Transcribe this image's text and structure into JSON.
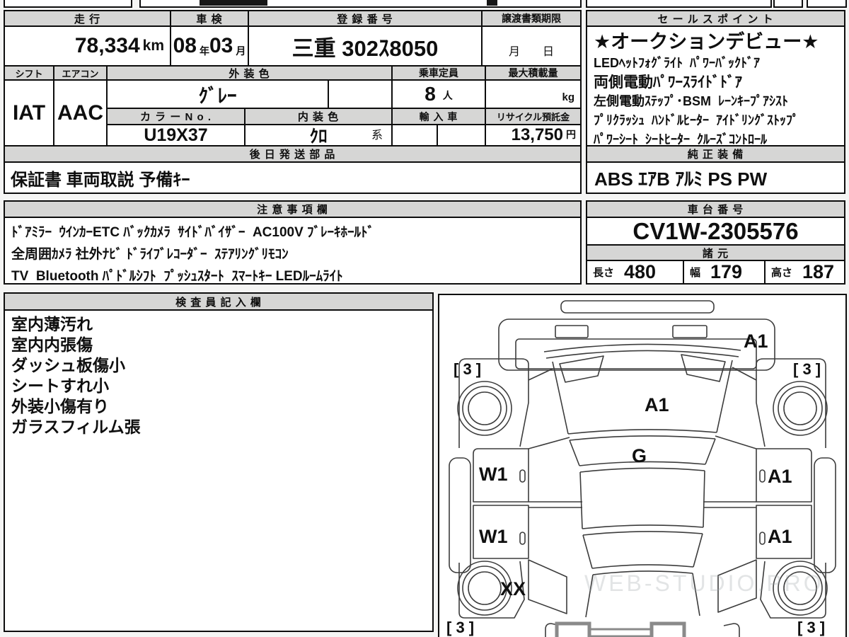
{
  "sheet": {
    "mileage": {
      "label": "走 行",
      "value": "78,334",
      "unit": "km"
    },
    "shaken": {
      "label": "車 検",
      "year": "08",
      "year_unit": "年",
      "month": "03",
      "month_unit": "月"
    },
    "registration": {
      "label": "登 録 番 号",
      "value": "三重 302ｽ8050"
    },
    "transfer_deadline": {
      "label": "譲渡書類期限",
      "value": "月　　日"
    },
    "shift": {
      "label": "シフト",
      "value": "IAT"
    },
    "aircon": {
      "label": "エアコン",
      "value": "AAC"
    },
    "exterior_color": {
      "label": "外 装 色",
      "value": "ｸﾞﾚｰ"
    },
    "capacity": {
      "label": "乗車定員",
      "value": "8",
      "unit": "人"
    },
    "max_load": {
      "label": "最大積載量",
      "unit": "kg"
    },
    "color_no": {
      "label": "カ ラ ー N o .",
      "value": "U19X37"
    },
    "interior_color": {
      "label": "内 装 色",
      "value": "ｸﾛ",
      "suffix": "系"
    },
    "import_car": {
      "label": "輸 入 車"
    },
    "recycle_fee": {
      "label": "リサイクル預託金",
      "value": "13,750",
      "unit": "円"
    },
    "later_parts": {
      "label": "後 日 発 送 部 品",
      "value": "保証書 車両取説 予備ｷｰ"
    },
    "sales_points": {
      "label": "セ ー ル ス ポ イ ン ト",
      "star_line": "★オークションデビュー★",
      "lines": [
        "LEDﾍｯﾄﾌｫｸﾞﾗｲﾄ  ﾊﾟﾜｰﾊﾞｯｸﾄﾞｱ",
        "両側電動ﾊﾟﾜｰｽﾗｲﾄﾞﾄﾞｱ",
        "左側電動ｽﾃｯﾌﾟ･BSM  ﾚｰﾝｷｰﾌﾟｱｼｽﾄ",
        "ﾌﾟﾘｸﾗｯｼｭ  ﾊﾝﾄﾞﾙﾋｰﾀｰ  ｱｲﾄﾞﾘﾝｸﾞｽﾄｯﾌﾟ",
        "ﾊﾟﾜｰｼｰﾄ  ｼｰﾄﾋｰﾀｰ  ｸﾙｰｽﾞｺﾝﾄﾛｰﾙ"
      ]
    },
    "genuine_equipment": {
      "label": "純 正 装 備",
      "value": "ABS ｴｱB ｱﾙﾐ PS PW"
    },
    "notes": {
      "label": "注 意 事 項 欄",
      "lines": [
        "ﾄﾞｱﾐﾗｰ  ｳｲﾝｶｰETC ﾊﾞｯｸｶﾒﾗ  ｻｲﾄﾞﾊﾞｲｻﾞｰ  AC100V ﾌﾞﾚｰｷﾎｰﾙﾄﾞ",
        "全周囲ｶﾒﾗ 社外ﾅﾋﾞ ﾄﾞﾗｲﾌﾞﾚｺｰﾀﾞｰ  ｽﾃｱﾘﾝｸﾞﾘﾓｺﾝ",
        "TV  Bluetooth ﾊﾟﾄﾞﾙｼﾌﾄ  ﾌﾟｯｼｭｽﾀｰﾄ  ｽﾏｰﾄｷｰ LEDﾙｰﾑﾗｲﾄ"
      ]
    },
    "chassis_no": {
      "label": "車 台 番 号",
      "value": "CV1W-2305576"
    },
    "specs": {
      "label": "諸 元",
      "dims": [
        {
          "label": "長さ",
          "value": "480"
        },
        {
          "label": "幅",
          "value": "179"
        },
        {
          "label": "高さ",
          "value": "187"
        }
      ]
    },
    "inspector_notes": {
      "label": "検 査 員 記 入 欄",
      "lines": [
        "室内薄汚れ",
        "室内内張傷",
        "ダッシュ板傷小",
        "シートすれ小",
        "外装小傷有り",
        "ガラスフィルム張"
      ]
    },
    "diagram": {
      "marks": {
        "rear_gate": "A1",
        "rear_window": "A1",
        "roof": "G",
        "left_slide_door": "W1",
        "left_rear_door": "W1",
        "left_front_fender": "XX",
        "right_slide_door": "A1",
        "right_rear_door": "A1",
        "tire_rear_left": "[ 3 ]",
        "tire_rear_right": "[ 3 ]",
        "tire_front_left": "[ 3 ]",
        "tire_front_right": "[ 3 ]"
      },
      "watermark": "WEB-STUDIO.PRO"
    }
  },
  "colors": {
    "border": "#0d0d0d",
    "header_bg": "#d6d6d5",
    "paper": "#ffffff",
    "diagram_stroke": "#3c3c3c",
    "headlight_gray": "#8a8a8a"
  }
}
